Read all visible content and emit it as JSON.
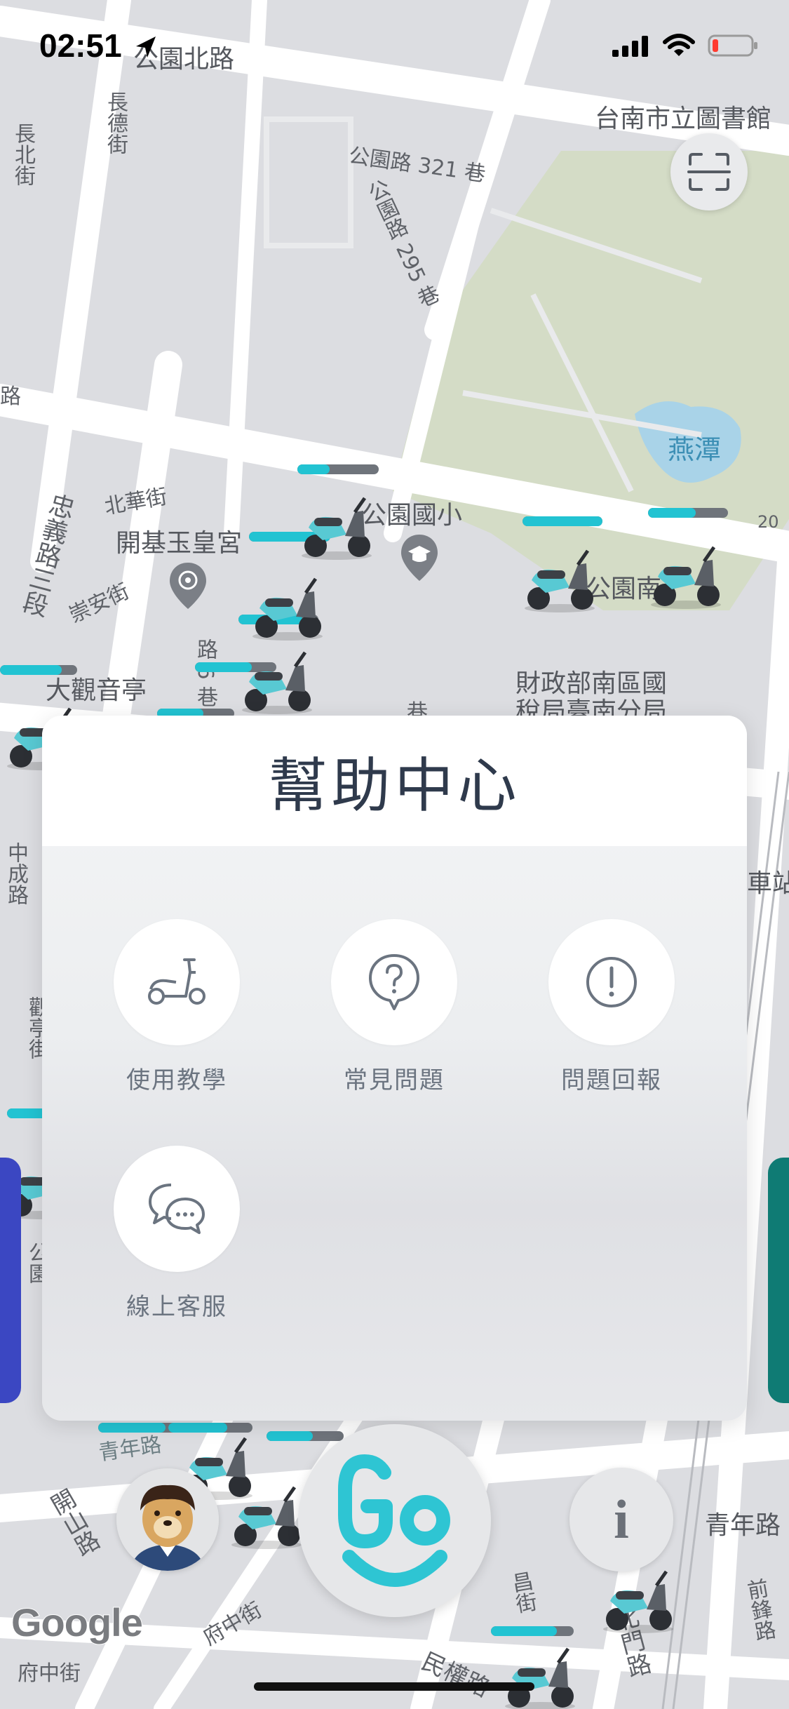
{
  "status_bar": {
    "time": "02:51",
    "battery_level": 0.12,
    "battery_color": "#ff3b30"
  },
  "map": {
    "labels": {
      "gongyuan_north": "公園北路",
      "changbei": "長北街",
      "changde": "長德街",
      "library": "台南市立圖書館",
      "lane321": "公園路 321 巷",
      "lane295": "公園路 295 巷",
      "lu": "路",
      "yantan": "燕潭",
      "route20": "20",
      "beihua": "北華街",
      "gongyuan_school": "公園國小",
      "kaiji_temple": "開基玉皇宮",
      "zhongyi": "忠義路三段",
      "chongan": "崇安街",
      "gongyuan_road": "公園南",
      "lane6": "路 6 巷",
      "guanyin": "大觀音亭",
      "tax_office_1": "財政部南區國",
      "tax_office_2": "稅局臺南分局",
      "xiang": "巷",
      "station": "車站",
      "zhongcheng": "中成路",
      "guanting": "觀亭街",
      "park_left": "公園",
      "qingnian": "青年路",
      "kaishan": "開山路",
      "fuzhong": "府中街",
      "fuzhong2": "府中街",
      "qianfeng": "前鋒路",
      "minquan": "民權路",
      "beimen": "北門路",
      "chengde": "昌街",
      "qingnian_left": "青年路"
    }
  },
  "help_center": {
    "title": "幫助中心",
    "items": [
      {
        "label": "使用教學",
        "icon": "scooter-icon"
      },
      {
        "label": "常見問題",
        "icon": "question-bubble-icon"
      },
      {
        "label": "問題回報",
        "icon": "exclamation-icon"
      },
      {
        "label": "線上客服",
        "icon": "chat-bubbles-icon"
      }
    ]
  },
  "controls": {
    "go_label": "Go",
    "info_label": "i",
    "google_label": "Google"
  },
  "colors": {
    "accent": "#22c3d2",
    "go_teal": "#2ec5d3",
    "title": "#2f3a4c"
  }
}
